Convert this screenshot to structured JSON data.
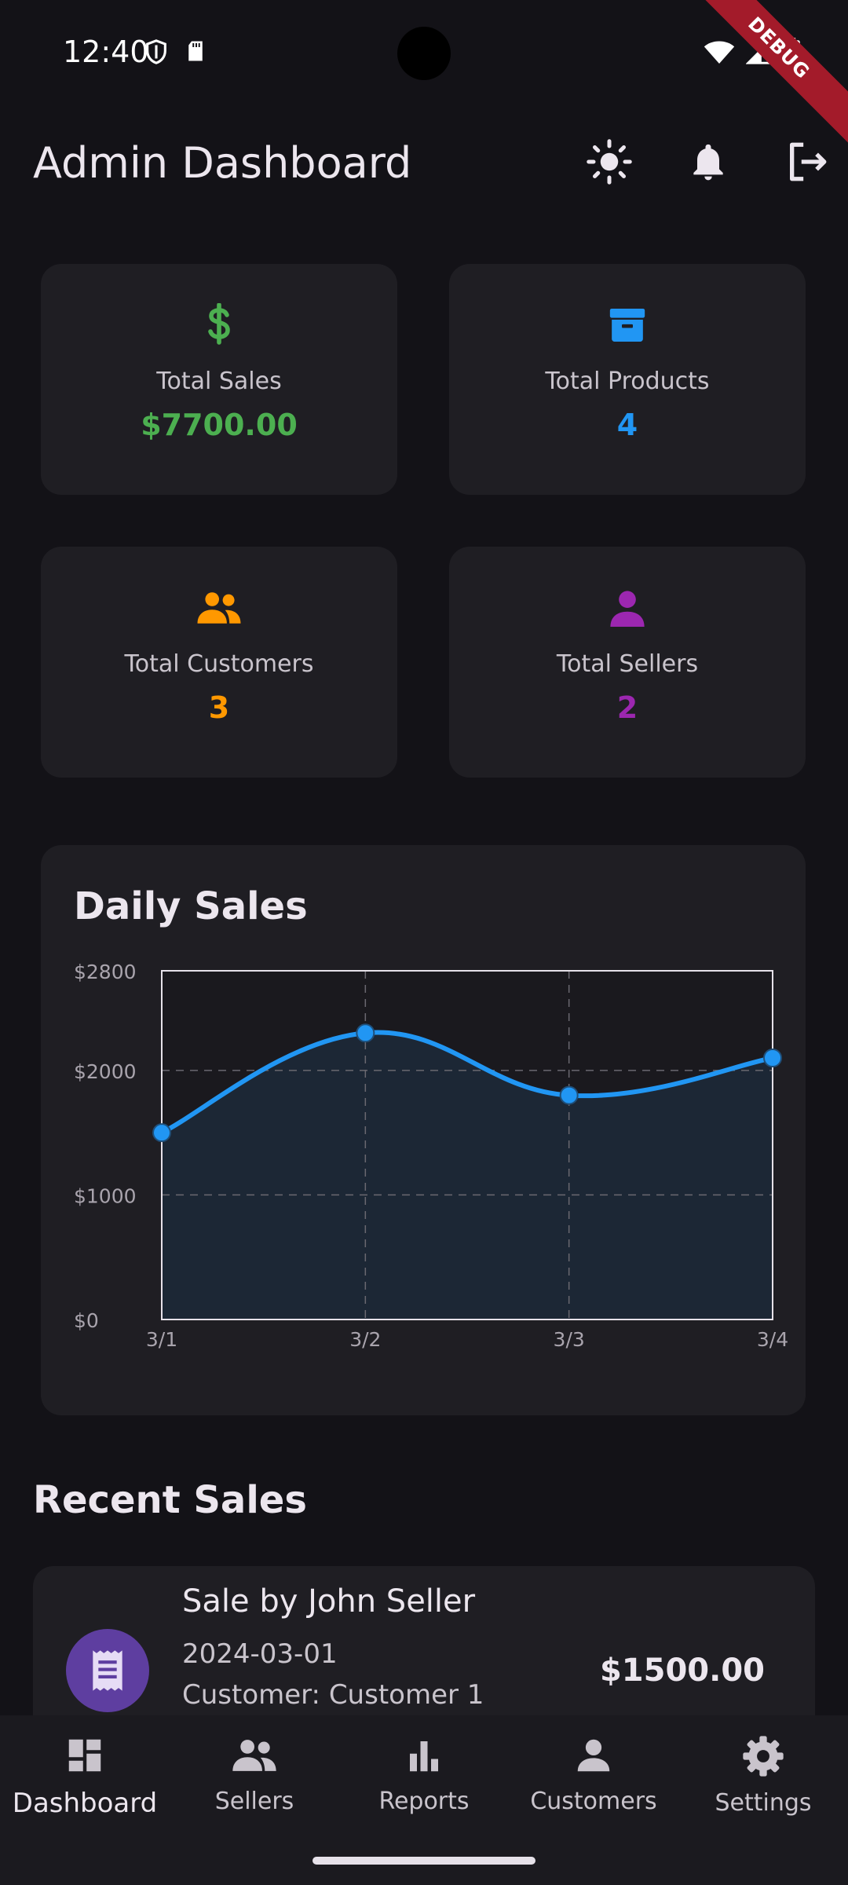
{
  "status_bar": {
    "time": "12:40",
    "debug_label": "DEBUG"
  },
  "app_bar": {
    "title": "Admin Dashboard",
    "actions": [
      "theme-toggle",
      "notifications",
      "logout"
    ]
  },
  "stats": [
    {
      "label": "Total Sales",
      "value": "$7700.00",
      "color": "#4caf50",
      "icon": "dollar-icon"
    },
    {
      "label": "Total Products",
      "value": "4",
      "color": "#2196f3",
      "icon": "archive-box-icon"
    },
    {
      "label": "Total Customers",
      "value": "3",
      "color": "#ff9800",
      "icon": "people-icon"
    },
    {
      "label": "Total Sellers",
      "value": "2",
      "color": "#9c27b0",
      "icon": "person-icon"
    }
  ],
  "chart": {
    "title": "Daily Sales",
    "line_color": "#2196f3",
    "fill_color": "#1c2735"
  },
  "chart_data": {
    "type": "line",
    "title": "Daily Sales",
    "x": [
      "3/1",
      "3/2",
      "3/3",
      "3/4"
    ],
    "series": [
      {
        "values": [
          1500,
          2300,
          1800,
          2100
        ]
      }
    ],
    "ylim": [
      0,
      2800
    ],
    "y_ticks": [
      0,
      1000,
      2000,
      2800
    ],
    "y_tick_labels": [
      "$0",
      "$1000",
      "$2000",
      "$2800"
    ],
    "grid": true,
    "area_fill": true
  },
  "recent_sales": {
    "title": "Recent Sales",
    "items": [
      {
        "title": "Sale by John Seller",
        "date": "2024-03-01",
        "customer": "Customer: Customer 1",
        "amount": "$1500.00"
      }
    ]
  },
  "bottom_nav": {
    "items": [
      {
        "label": "Dashboard",
        "icon": "dashboard-icon",
        "active": true
      },
      {
        "label": "Sellers",
        "icon": "people-icon",
        "active": false
      },
      {
        "label": "Reports",
        "icon": "bar-chart-icon",
        "active": false
      },
      {
        "label": "Customers",
        "icon": "person-icon",
        "active": false
      },
      {
        "label": "Settings",
        "icon": "gear-icon",
        "active": false
      }
    ]
  }
}
